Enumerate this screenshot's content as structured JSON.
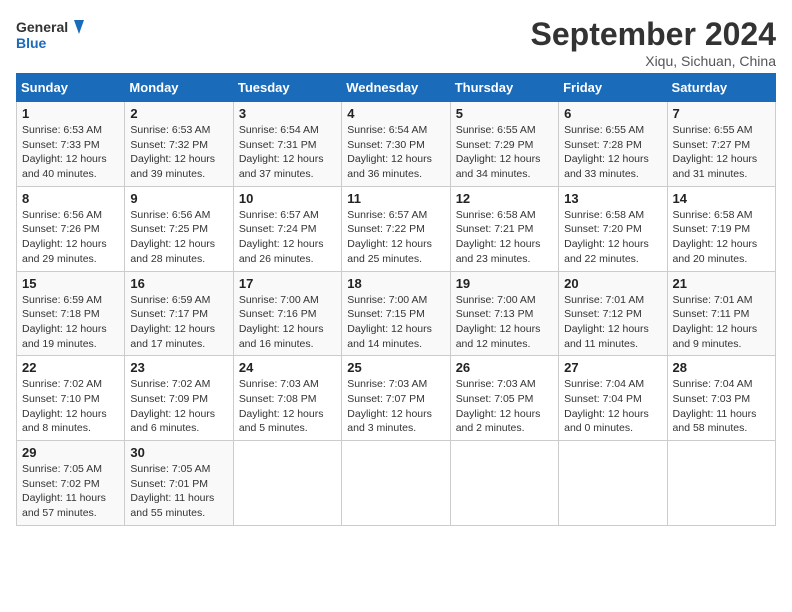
{
  "header": {
    "logo_line1": "General",
    "logo_line2": "Blue",
    "month_title": "September 2024",
    "subtitle": "Xiqu, Sichuan, China"
  },
  "columns": [
    "Sunday",
    "Monday",
    "Tuesday",
    "Wednesday",
    "Thursday",
    "Friday",
    "Saturday"
  ],
  "weeks": [
    [
      {
        "day": "1",
        "rise": "6:53 AM",
        "set": "7:33 PM",
        "hours": "12 hours",
        "minutes": "40 minutes"
      },
      {
        "day": "2",
        "rise": "6:53 AM",
        "set": "7:32 PM",
        "hours": "12 hours",
        "minutes": "39 minutes"
      },
      {
        "day": "3",
        "rise": "6:54 AM",
        "set": "7:31 PM",
        "hours": "12 hours",
        "minutes": "37 minutes"
      },
      {
        "day": "4",
        "rise": "6:54 AM",
        "set": "7:30 PM",
        "hours": "12 hours",
        "minutes": "36 minutes"
      },
      {
        "day": "5",
        "rise": "6:55 AM",
        "set": "7:29 PM",
        "hours": "12 hours",
        "minutes": "34 minutes"
      },
      {
        "day": "6",
        "rise": "6:55 AM",
        "set": "7:28 PM",
        "hours": "12 hours",
        "minutes": "33 minutes"
      },
      {
        "day": "7",
        "rise": "6:55 AM",
        "set": "7:27 PM",
        "hours": "12 hours",
        "minutes": "31 minutes"
      }
    ],
    [
      {
        "day": "8",
        "rise": "6:56 AM",
        "set": "7:26 PM",
        "hours": "12 hours",
        "minutes": "29 minutes"
      },
      {
        "day": "9",
        "rise": "6:56 AM",
        "set": "7:25 PM",
        "hours": "12 hours",
        "minutes": "28 minutes"
      },
      {
        "day": "10",
        "rise": "6:57 AM",
        "set": "7:24 PM",
        "hours": "12 hours",
        "minutes": "26 minutes"
      },
      {
        "day": "11",
        "rise": "6:57 AM",
        "set": "7:22 PM",
        "hours": "12 hours",
        "minutes": "25 minutes"
      },
      {
        "day": "12",
        "rise": "6:58 AM",
        "set": "7:21 PM",
        "hours": "12 hours",
        "minutes": "23 minutes"
      },
      {
        "day": "13",
        "rise": "6:58 AM",
        "set": "7:20 PM",
        "hours": "12 hours",
        "minutes": "22 minutes"
      },
      {
        "day": "14",
        "rise": "6:58 AM",
        "set": "7:19 PM",
        "hours": "12 hours",
        "minutes": "20 minutes"
      }
    ],
    [
      {
        "day": "15",
        "rise": "6:59 AM",
        "set": "7:18 PM",
        "hours": "12 hours",
        "minutes": "19 minutes"
      },
      {
        "day": "16",
        "rise": "6:59 AM",
        "set": "7:17 PM",
        "hours": "12 hours",
        "minutes": "17 minutes"
      },
      {
        "day": "17",
        "rise": "7:00 AM",
        "set": "7:16 PM",
        "hours": "12 hours",
        "minutes": "16 minutes"
      },
      {
        "day": "18",
        "rise": "7:00 AM",
        "set": "7:15 PM",
        "hours": "12 hours",
        "minutes": "14 minutes"
      },
      {
        "day": "19",
        "rise": "7:00 AM",
        "set": "7:13 PM",
        "hours": "12 hours",
        "minutes": "12 minutes"
      },
      {
        "day": "20",
        "rise": "7:01 AM",
        "set": "7:12 PM",
        "hours": "12 hours",
        "minutes": "11 minutes"
      },
      {
        "day": "21",
        "rise": "7:01 AM",
        "set": "7:11 PM",
        "hours": "12 hours",
        "minutes": "9 minutes"
      }
    ],
    [
      {
        "day": "22",
        "rise": "7:02 AM",
        "set": "7:10 PM",
        "hours": "12 hours",
        "minutes": "8 minutes"
      },
      {
        "day": "23",
        "rise": "7:02 AM",
        "set": "7:09 PM",
        "hours": "12 hours",
        "minutes": "6 minutes"
      },
      {
        "day": "24",
        "rise": "7:03 AM",
        "set": "7:08 PM",
        "hours": "12 hours",
        "minutes": "5 minutes"
      },
      {
        "day": "25",
        "rise": "7:03 AM",
        "set": "7:07 PM",
        "hours": "12 hours",
        "minutes": "3 minutes"
      },
      {
        "day": "26",
        "rise": "7:03 AM",
        "set": "7:05 PM",
        "hours": "12 hours",
        "minutes": "2 minutes"
      },
      {
        "day": "27",
        "rise": "7:04 AM",
        "set": "7:04 PM",
        "hours": "12 hours",
        "minutes": "0 minutes"
      },
      {
        "day": "28",
        "rise": "7:04 AM",
        "set": "7:03 PM",
        "hours": "11 hours",
        "minutes": "58 minutes"
      }
    ],
    [
      {
        "day": "29",
        "rise": "7:05 AM",
        "set": "7:02 PM",
        "hours": "11 hours",
        "minutes": "57 minutes"
      },
      {
        "day": "30",
        "rise": "7:05 AM",
        "set": "7:01 PM",
        "hours": "11 hours",
        "minutes": "55 minutes"
      },
      null,
      null,
      null,
      null,
      null
    ]
  ],
  "labels": {
    "sunrise": "Sunrise:",
    "sunset": "Sunset:",
    "daylight": "Daylight:",
    "and": "and"
  }
}
